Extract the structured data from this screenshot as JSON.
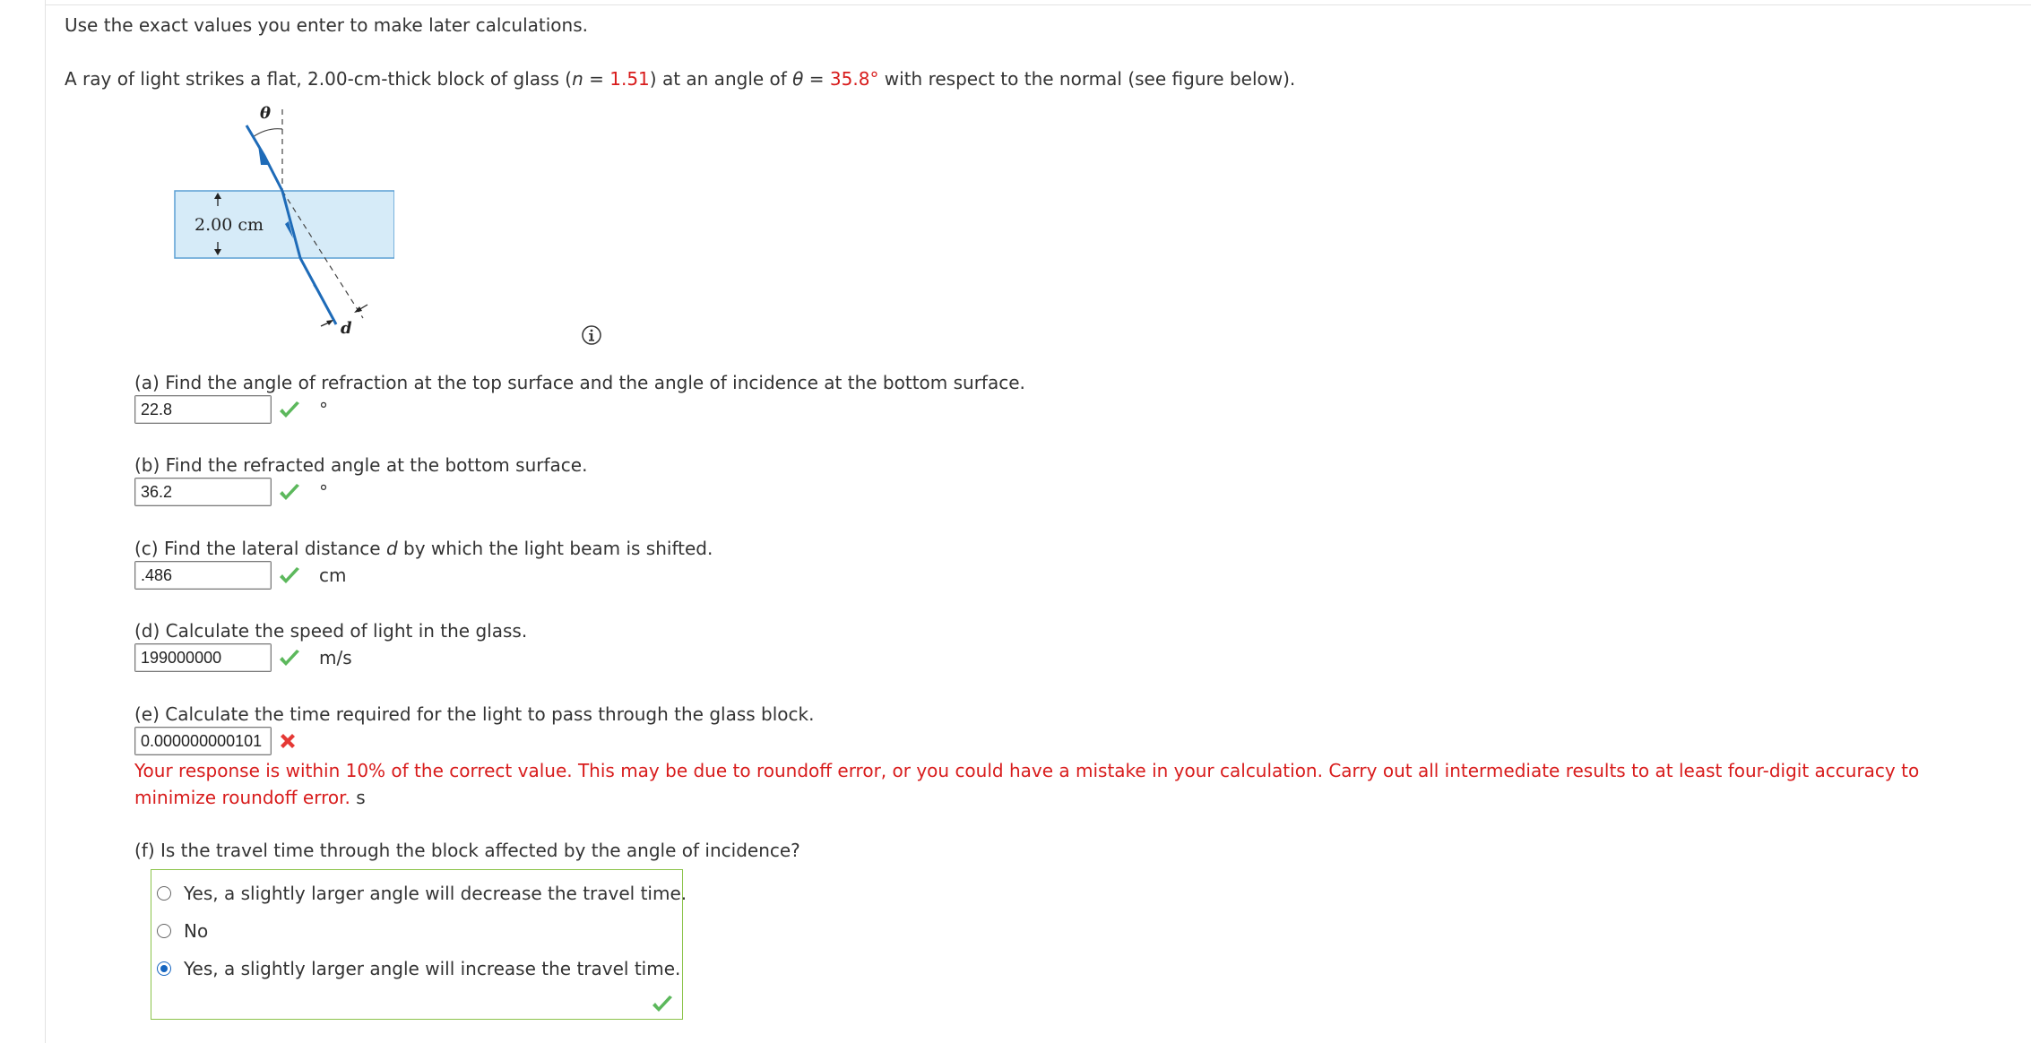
{
  "instruction": "Use the exact values you enter to make later calculations.",
  "problem": {
    "part1": "A ray of light strikes a flat, 2.00-cm-thick block of glass (",
    "n_symbol": "n",
    "eq1": " = ",
    "n_value": "1.51",
    "part2": ") at an angle of ",
    "theta_symbol": "θ",
    "eq2": " = ",
    "theta_value": "35.8°",
    "part3": " with respect to the normal (see figure below)."
  },
  "figure": {
    "theta_label": "θ",
    "thickness_label": "2.00 cm",
    "d_label": "d"
  },
  "colors": {
    "accent_red": "#d81c1c",
    "check_green": "#5cb85c",
    "cross_red": "#e53935",
    "radio_blue": "#1565c0",
    "glass_fill": "#d6ebf8",
    "ray_blue": "#1e6bb8"
  },
  "questions": [
    {
      "label": "(a) Find the angle of refraction at the top surface and the angle of incidence at the bottom surface.",
      "value": "22.8",
      "unit": "°",
      "status": "correct"
    },
    {
      "label": "(b) Find the refracted angle at the bottom surface.",
      "value": "36.2",
      "unit": "°",
      "status": "correct"
    },
    {
      "label_pre": "(c) Find the lateral distance ",
      "label_var": "d",
      "label_post": " by which the light beam is shifted.",
      "value": ".486",
      "unit": "cm",
      "status": "correct"
    },
    {
      "label": "(d) Calculate the speed of light in the glass.",
      "value": "199000000",
      "unit": "m/s",
      "status": "correct"
    },
    {
      "label": "(e) Calculate the time required for the light to pass through the glass block.",
      "value": "0.000000000101",
      "status": "incorrect",
      "feedback": "Your response is within 10% of the correct value. This may be due to roundoff error, or you could have a mistake in your calculation. Carry out all intermediate results to at least four-digit accuracy to minimize roundoff error.",
      "unit": "s"
    }
  ],
  "question_f": {
    "label": "(f) Is the travel time through the block affected by the angle of incidence?",
    "options": [
      "Yes, a slightly larger angle will decrease the travel time.",
      "No",
      "Yes, a slightly larger angle will increase the travel time."
    ],
    "selected_index": 2,
    "status": "correct"
  },
  "icons": {
    "info": "info-icon",
    "correct": "checkmark-icon",
    "incorrect": "cross-icon"
  }
}
